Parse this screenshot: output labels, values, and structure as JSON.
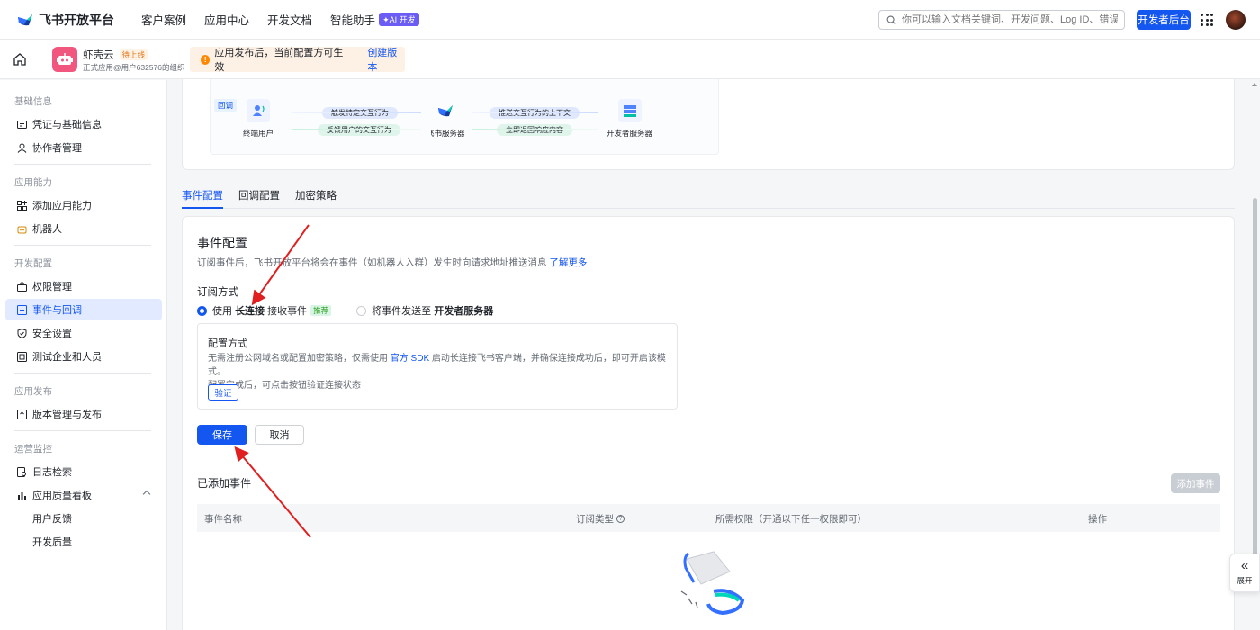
{
  "topbar": {
    "logo_text": "飞书开放平台",
    "nav": [
      "客户案例",
      "应用中心",
      "开发文档",
      "智能助手"
    ],
    "ai_badge": "✦AI 开发",
    "search_placeholder": "你可以输入文档关键词、开发问题、Log ID、错误码",
    "dev_console": "开发者后台"
  },
  "app": {
    "name": "虾壳云",
    "status": "待上线",
    "subtitle": "正式应用@用户632576的组织"
  },
  "notice": {
    "text": "应用发布后，当前配置方可生效",
    "link": "创建版本"
  },
  "sidebar": {
    "sections": [
      {
        "title": "基础信息",
        "items": [
          {
            "label": "凭证与基础信息",
            "icon": "credential-icon"
          },
          {
            "label": "协作者管理",
            "icon": "user-icon"
          }
        ]
      },
      {
        "title": "应用能力",
        "items": [
          {
            "label": "添加应用能力",
            "icon": "add-capability-icon"
          },
          {
            "label": "机器人",
            "icon": "robot-icon"
          }
        ]
      },
      {
        "title": "开发配置",
        "items": [
          {
            "label": "权限管理",
            "icon": "permission-icon"
          },
          {
            "label": "事件与回调",
            "icon": "event-icon"
          },
          {
            "label": "安全设置",
            "icon": "shield-icon"
          },
          {
            "label": "测试企业和人员",
            "icon": "test-icon"
          }
        ]
      },
      {
        "title": "应用发布",
        "items": [
          {
            "label": "版本管理与发布",
            "icon": "upload-icon"
          }
        ]
      },
      {
        "title": "运营监控",
        "items": [
          {
            "label": "日志检索",
            "icon": "log-icon"
          },
          {
            "label": "应用质量看板",
            "icon": "chart-icon"
          },
          {
            "label": "用户反馈"
          },
          {
            "label": "开发质量"
          }
        ]
      }
    ],
    "active": "事件与回调"
  },
  "flow": {
    "tag": "回调",
    "user": "终端用户",
    "feishu_server": "飞书服务器",
    "dev_server": "开发者服务器",
    "trigger": "触发特定交互行为",
    "feedback": "反馈用户的交互行为",
    "push_ctx": "推送交互行为的上下文",
    "respond": "立即返回响应内容"
  },
  "tabs": [
    "事件配置",
    "回调配置",
    "加密策略"
  ],
  "event_config": {
    "title": "事件配置",
    "desc": "订阅事件后，飞书开放平台将会在事件（如机器人入群）发生时向请求地址推送消息",
    "learn_more": "了解更多",
    "sub_method_label": "订阅方式",
    "option1_pre": "使用",
    "option1_bold": "长连接",
    "option1_post": "接收事件",
    "recommend": "推荐",
    "option2_pre": "将事件发送至",
    "option2_bold": "开发者服务器",
    "config_title": "配置方式",
    "config_text1": "无需注册公网域名或配置加密策略，仅需使用",
    "config_link": "官方 SDK",
    "config_text2": "启动长连接飞书客户端，并确保连接成功后，即可开启该模式。",
    "config_text3": "配置完成后，可点击按钮验证连接状态",
    "verify": "验证",
    "save": "保存",
    "cancel": "取消"
  },
  "added_events": {
    "title": "已添加事件",
    "add_button": "添加事件",
    "columns": [
      "事件名称",
      "订阅类型",
      "所需权限（开通以下任一权限即可）",
      "操作"
    ]
  },
  "expand": {
    "label": "展开"
  },
  "colors": {
    "primary": "#1456f0",
    "annotation_arrow": "#e02020"
  }
}
